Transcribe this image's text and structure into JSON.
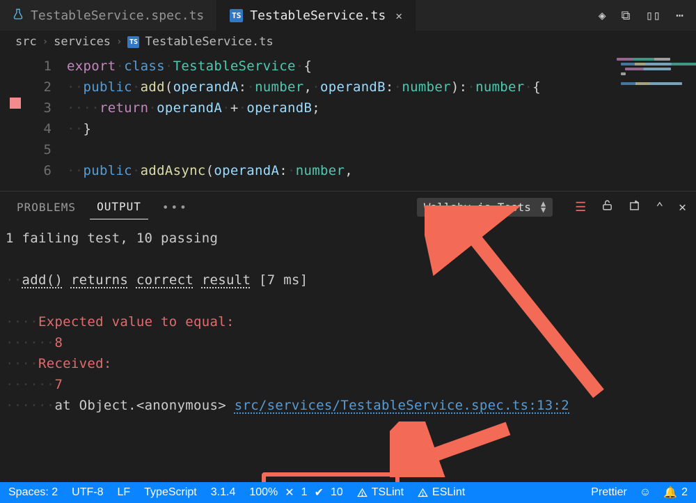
{
  "tabs": [
    {
      "label": "TestableService.spec.ts",
      "icon": "flask",
      "active": false
    },
    {
      "label": "TestableService.ts",
      "icon": "ts",
      "active": true
    }
  ],
  "breadcrumb": {
    "seg0": "src",
    "seg1": "services",
    "seg2": "TestableService.ts"
  },
  "editor": {
    "minimap_colors": [
      [
        "#c586c0",
        "#4ec9b0",
        "#d4d4d4"
      ],
      [
        "#569cd6",
        "#dcdcaa",
        "#9cdcfe",
        "#4ec9b0"
      ],
      [
        "#c586c0",
        "#9cdcfe"
      ],
      [
        "#d4d4d4"
      ],
      [],
      [
        "#569cd6",
        "#dcdcaa",
        "#9cdcfe"
      ]
    ],
    "lines": {
      "1": {
        "n": "1"
      },
      "2": {
        "n": "2"
      },
      "3": {
        "n": "3"
      },
      "4": {
        "n": "4"
      },
      "5": {
        "n": "5"
      },
      "6": {
        "n": "6"
      }
    },
    "tok": {
      "l1": {
        "export": "export",
        "class": "class",
        "name": "TestableService",
        "brace": "{"
      },
      "l2": {
        "public": "public",
        "fn": "add",
        "p1": "operandA",
        "t1": "number",
        "p2": "operandB",
        "t2": "number",
        "ret": "number",
        "brace": "{"
      },
      "l3": {
        "return": "return",
        "a": "operandA",
        "op": "+",
        "b": "operandB",
        "semi": ";"
      },
      "l4": {
        "brace": "}"
      },
      "l6": {
        "public": "public",
        "fn": "addAsync",
        "p1": "operandA",
        "t1": "number",
        "comma": ","
      }
    }
  },
  "panel": {
    "tabs": {
      "problems": "PROBLEMS",
      "output": "OUTPUT",
      "more": "•••"
    },
    "select": "Wallaby.js Tests",
    "summary": "1 failing test, 10 passing",
    "test": {
      "w0": "add()",
      "w1": "returns",
      "w2": "correct",
      "w3": "result",
      "time": "[7 ms]"
    },
    "err": {
      "l1": "Expected value to equal:",
      "l2": "8",
      "l3": "Received:",
      "l4": "7"
    },
    "trace": {
      "prefix": "at Object.<anonymous>",
      "link": "src/services/TestableService.spec.ts:13:2"
    }
  },
  "status": {
    "spaces": "Spaces: 2",
    "enc": "UTF-8",
    "eol": "LF",
    "lang": "TypeScript",
    "ver": "3.1.4",
    "wallaby": {
      "pct": "100%",
      "fail": "1",
      "pass": "10"
    },
    "tslint": "TSLint",
    "eslint": "ESLint",
    "prettier": "Prettier",
    "bell": "2"
  }
}
